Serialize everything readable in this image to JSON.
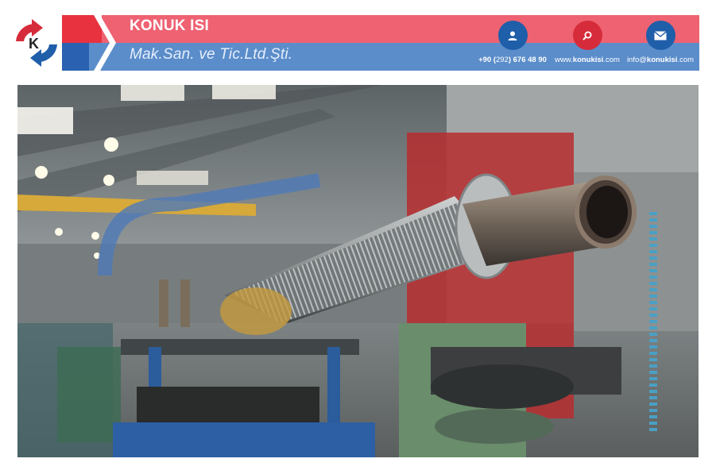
{
  "brand": {
    "title": "KONUK ISI",
    "subtitle": "Mak.San. ve Tic.Ltd.Şti.",
    "logo_letter": "K"
  },
  "contacts": [
    {
      "icon": "user-icon",
      "prefix": "+90 (",
      "mid": "292",
      "main": ") 676 48 90",
      "suffix": ""
    },
    {
      "icon": "search-icon",
      "prefix": "www.",
      "mid": "",
      "main": "konukisi",
      "suffix": ".com"
    },
    {
      "icon": "mail-icon",
      "prefix": "info@",
      "mid": "",
      "main": "konukisi",
      "suffix": ".com"
    }
  ],
  "colors": {
    "red": "#ee6272",
    "blue": "#5b8dca",
    "dark_red": "#d62b3a",
    "dark_blue": "#1f5ea9"
  },
  "hero": {
    "image": "finned-tube-factory-photo"
  }
}
